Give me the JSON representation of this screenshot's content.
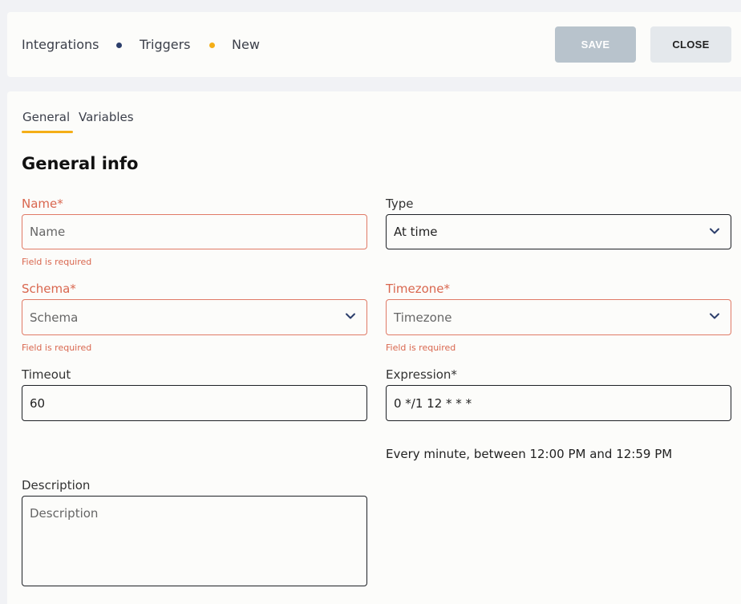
{
  "breadcrumb": {
    "items": [
      "Integrations",
      "Triggers",
      "New"
    ],
    "dot_colors": [
      "#2c3e6b",
      "#f4ae17"
    ]
  },
  "actions": {
    "save_label": "SAVE",
    "close_label": "CLOSE"
  },
  "tabs": [
    {
      "label": "General",
      "active": true
    },
    {
      "label": "Variables",
      "active": false
    }
  ],
  "section_title": "General info",
  "form": {
    "name": {
      "label": "Name*",
      "placeholder": "Name",
      "error": "Field is required"
    },
    "type": {
      "label": "Type",
      "value": "At time"
    },
    "schema": {
      "label": "Schema*",
      "placeholder": "Schema",
      "error": "Field is required"
    },
    "timezone": {
      "label": "Timezone*",
      "placeholder": "Timezone",
      "error": "Field is required"
    },
    "timeout": {
      "label": "Timeout",
      "value": "60"
    },
    "expression": {
      "label": "Expression*",
      "value": "0 */1 12 * * *",
      "description": "Every minute, between 12:00 PM and 12:59 PM"
    },
    "description": {
      "label": "Description",
      "placeholder": "Description"
    }
  },
  "colors": {
    "accent": "#f4ae17",
    "error": "#d9674f",
    "save_disabled": "#b8c3cc",
    "chevron": "#2c3e6b"
  }
}
